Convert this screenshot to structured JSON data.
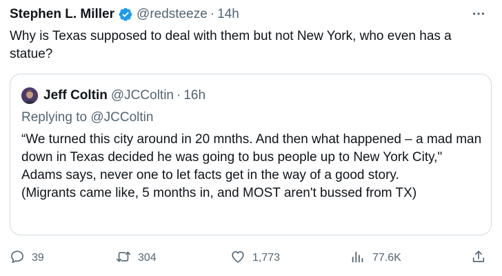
{
  "tweet": {
    "author_name": "Stephen L. Miller",
    "handle": "@redsteeze",
    "separator": "·",
    "time": "14h",
    "text": "Why is Texas supposed to deal with them but not New York, who even has a statue?",
    "verified_icon": "verified-badge-icon",
    "more_icon": "more-icon"
  },
  "quote": {
    "author_name": "Jeff Coltin",
    "handle": "@JCColtin",
    "separator": "·",
    "time": "16h",
    "replying_prefix": "Replying to ",
    "replying_handle": "@JCColtin",
    "text_line1": "“We turned this city around in 20 mnths. And then what happened – a mad man down in Texas decided he was going to bus people up to New York City,\" Adams says, never one to let facts get in the way of a good story.",
    "text_line2": "(Migrants came like, 5 months in, and MOST aren't bussed from TX)"
  },
  "actions": {
    "reply": {
      "icon": "reply-icon",
      "count": "39"
    },
    "retweet": {
      "icon": "retweet-icon",
      "count": "304"
    },
    "like": {
      "icon": "like-icon",
      "count": "1,773"
    },
    "views": {
      "icon": "views-icon",
      "count": "77.6K"
    },
    "share": {
      "icon": "share-icon"
    }
  },
  "colors": {
    "text": "#0f1419",
    "secondary": "#536471",
    "border": "#cfd9de",
    "verified": "#1d9bf0"
  }
}
